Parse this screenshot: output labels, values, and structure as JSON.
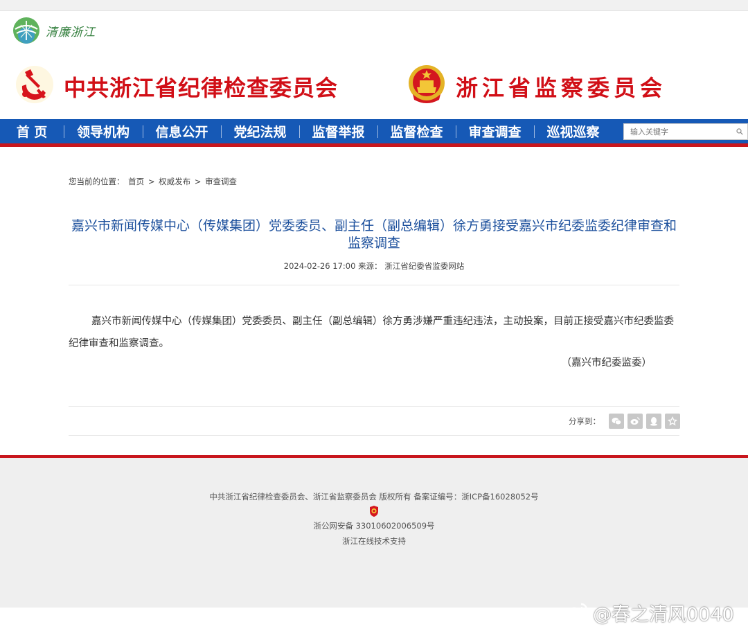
{
  "site": {
    "small_logo_text": "清廉浙江",
    "title_party": "中共浙江省纪律检查委员会",
    "title_state": "浙江省监察委员会"
  },
  "nav": {
    "items": [
      {
        "label": "首 页"
      },
      {
        "label": "领导机构"
      },
      {
        "label": "信息公开"
      },
      {
        "label": "党纪法规"
      },
      {
        "label": "监督举报"
      },
      {
        "label": "监督检查"
      },
      {
        "label": "审查调查"
      },
      {
        "label": "巡视巡察"
      }
    ],
    "search_placeholder": "输入关键字"
  },
  "breadcrumb": {
    "prefix": "您当前的位置：",
    "items": [
      "首页",
      "权威发布",
      "审查调查"
    ],
    "separator": ">"
  },
  "article": {
    "title": "嘉兴市新闻传媒中心（传媒集团）党委委员、副主任（副总编辑）徐方勇接受嘉兴市纪委监委纪律审查和监察调查",
    "datetime": "2024-02-26 17:00",
    "source_label": "来源：",
    "source": "浙江省纪委省监委网站",
    "body": "嘉兴市新闻传媒中心（传媒集团）党委委员、副主任（副总编辑）徐方勇涉嫌严重违纪违法，主动投案，目前正接受嘉兴市纪委监委纪律审查和监察调查。",
    "signature": "（嘉兴市纪委监委）"
  },
  "share": {
    "label": "分享到：",
    "icons": [
      "wechat-icon",
      "weibo-icon",
      "qq-icon",
      "favorite-icon"
    ]
  },
  "footer": {
    "copyright": "中共浙江省纪律检查委员会、浙江省监察委员会  版权所有  备案证编号：浙ICP备16028052号",
    "police_record": "浙公网安备 33010602006509号",
    "tech_support": "浙江在线技术支持"
  },
  "watermark": {
    "text": "@春之清风0040"
  },
  "colors": {
    "nav_blue": "#1659b6",
    "accent_red": "#c8161d",
    "title_red": "#d10f17",
    "article_title_blue": "#1b4f9c"
  }
}
